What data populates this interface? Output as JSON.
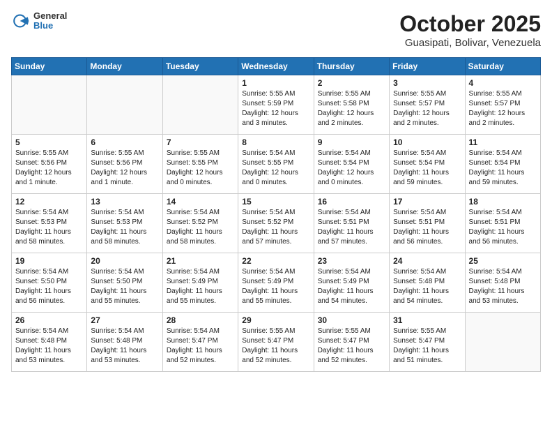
{
  "header": {
    "logo_general": "General",
    "logo_blue": "Blue",
    "month_title": "October 2025",
    "location": "Guasipati, Bolivar, Venezuela"
  },
  "days_of_week": [
    "Sunday",
    "Monday",
    "Tuesday",
    "Wednesday",
    "Thursday",
    "Friday",
    "Saturday"
  ],
  "weeks": [
    [
      {
        "day": "",
        "content": ""
      },
      {
        "day": "",
        "content": ""
      },
      {
        "day": "",
        "content": ""
      },
      {
        "day": "1",
        "content": "Sunrise: 5:55 AM\nSunset: 5:59 PM\nDaylight: 12 hours and 3 minutes."
      },
      {
        "day": "2",
        "content": "Sunrise: 5:55 AM\nSunset: 5:58 PM\nDaylight: 12 hours and 2 minutes."
      },
      {
        "day": "3",
        "content": "Sunrise: 5:55 AM\nSunset: 5:57 PM\nDaylight: 12 hours and 2 minutes."
      },
      {
        "day": "4",
        "content": "Sunrise: 5:55 AM\nSunset: 5:57 PM\nDaylight: 12 hours and 2 minutes."
      }
    ],
    [
      {
        "day": "5",
        "content": "Sunrise: 5:55 AM\nSunset: 5:56 PM\nDaylight: 12 hours and 1 minute."
      },
      {
        "day": "6",
        "content": "Sunrise: 5:55 AM\nSunset: 5:56 PM\nDaylight: 12 hours and 1 minute."
      },
      {
        "day": "7",
        "content": "Sunrise: 5:55 AM\nSunset: 5:55 PM\nDaylight: 12 hours and 0 minutes."
      },
      {
        "day": "8",
        "content": "Sunrise: 5:54 AM\nSunset: 5:55 PM\nDaylight: 12 hours and 0 minutes."
      },
      {
        "day": "9",
        "content": "Sunrise: 5:54 AM\nSunset: 5:54 PM\nDaylight: 12 hours and 0 minutes."
      },
      {
        "day": "10",
        "content": "Sunrise: 5:54 AM\nSunset: 5:54 PM\nDaylight: 11 hours and 59 minutes."
      },
      {
        "day": "11",
        "content": "Sunrise: 5:54 AM\nSunset: 5:54 PM\nDaylight: 11 hours and 59 minutes."
      }
    ],
    [
      {
        "day": "12",
        "content": "Sunrise: 5:54 AM\nSunset: 5:53 PM\nDaylight: 11 hours and 58 minutes."
      },
      {
        "day": "13",
        "content": "Sunrise: 5:54 AM\nSunset: 5:53 PM\nDaylight: 11 hours and 58 minutes."
      },
      {
        "day": "14",
        "content": "Sunrise: 5:54 AM\nSunset: 5:52 PM\nDaylight: 11 hours and 58 minutes."
      },
      {
        "day": "15",
        "content": "Sunrise: 5:54 AM\nSunset: 5:52 PM\nDaylight: 11 hours and 57 minutes."
      },
      {
        "day": "16",
        "content": "Sunrise: 5:54 AM\nSunset: 5:51 PM\nDaylight: 11 hours and 57 minutes."
      },
      {
        "day": "17",
        "content": "Sunrise: 5:54 AM\nSunset: 5:51 PM\nDaylight: 11 hours and 56 minutes."
      },
      {
        "day": "18",
        "content": "Sunrise: 5:54 AM\nSunset: 5:51 PM\nDaylight: 11 hours and 56 minutes."
      }
    ],
    [
      {
        "day": "19",
        "content": "Sunrise: 5:54 AM\nSunset: 5:50 PM\nDaylight: 11 hours and 56 minutes."
      },
      {
        "day": "20",
        "content": "Sunrise: 5:54 AM\nSunset: 5:50 PM\nDaylight: 11 hours and 55 minutes."
      },
      {
        "day": "21",
        "content": "Sunrise: 5:54 AM\nSunset: 5:49 PM\nDaylight: 11 hours and 55 minutes."
      },
      {
        "day": "22",
        "content": "Sunrise: 5:54 AM\nSunset: 5:49 PM\nDaylight: 11 hours and 55 minutes."
      },
      {
        "day": "23",
        "content": "Sunrise: 5:54 AM\nSunset: 5:49 PM\nDaylight: 11 hours and 54 minutes."
      },
      {
        "day": "24",
        "content": "Sunrise: 5:54 AM\nSunset: 5:48 PM\nDaylight: 11 hours and 54 minutes."
      },
      {
        "day": "25",
        "content": "Sunrise: 5:54 AM\nSunset: 5:48 PM\nDaylight: 11 hours and 53 minutes."
      }
    ],
    [
      {
        "day": "26",
        "content": "Sunrise: 5:54 AM\nSunset: 5:48 PM\nDaylight: 11 hours and 53 minutes."
      },
      {
        "day": "27",
        "content": "Sunrise: 5:54 AM\nSunset: 5:48 PM\nDaylight: 11 hours and 53 minutes."
      },
      {
        "day": "28",
        "content": "Sunrise: 5:54 AM\nSunset: 5:47 PM\nDaylight: 11 hours and 52 minutes."
      },
      {
        "day": "29",
        "content": "Sunrise: 5:55 AM\nSunset: 5:47 PM\nDaylight: 11 hours and 52 minutes."
      },
      {
        "day": "30",
        "content": "Sunrise: 5:55 AM\nSunset: 5:47 PM\nDaylight: 11 hours and 52 minutes."
      },
      {
        "day": "31",
        "content": "Sunrise: 5:55 AM\nSunset: 5:47 PM\nDaylight: 11 hours and 51 minutes."
      },
      {
        "day": "",
        "content": ""
      }
    ]
  ]
}
